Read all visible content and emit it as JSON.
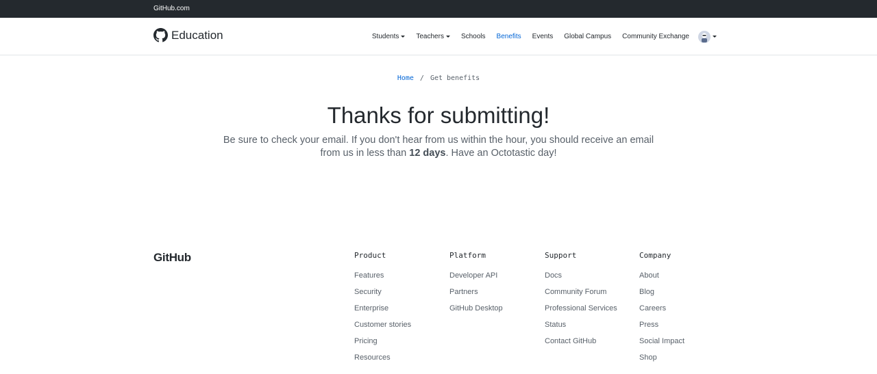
{
  "topbar": {
    "link": "GitHub.com"
  },
  "header": {
    "brand": "Education",
    "nav": [
      {
        "label": "Students",
        "dropdown": true
      },
      {
        "label": "Teachers",
        "dropdown": true
      },
      {
        "label": "Schools",
        "dropdown": false
      },
      {
        "label": "Benefits",
        "dropdown": false,
        "active": true
      },
      {
        "label": "Events",
        "dropdown": false
      },
      {
        "label": "Global Campus",
        "dropdown": false
      },
      {
        "label": "Community Exchange",
        "dropdown": false
      }
    ],
    "avatar_icon": "avatar-icon"
  },
  "breadcrumb": {
    "home": "Home",
    "separator": "/",
    "current": "Get benefits"
  },
  "main": {
    "title": "Thanks for submitting!",
    "lead_before": "Be sure to check your email. If you don't hear from us within the hour, you should receive an email from us in less than ",
    "lead_bold": "12 days",
    "lead_after": ". Have an Octotastic day!"
  },
  "footer": {
    "logo": "GitHub",
    "columns": [
      {
        "title": "Product",
        "links": [
          "Features",
          "Security",
          "Enterprise",
          "Customer stories",
          "Pricing",
          "Resources"
        ]
      },
      {
        "title": "Platform",
        "links": [
          "Developer API",
          "Partners",
          "GitHub Desktop"
        ]
      },
      {
        "title": "Support",
        "links": [
          "Docs",
          "Community Forum",
          "Professional Services",
          "Status",
          "Contact GitHub"
        ]
      },
      {
        "title": "Company",
        "links": [
          "About",
          "Blog",
          "Careers",
          "Press",
          "Social Impact",
          "Shop"
        ]
      }
    ]
  },
  "colors": {
    "topbar": "#24292e",
    "link": "#0366d6",
    "text": "#24292e",
    "muted": "#586069"
  }
}
